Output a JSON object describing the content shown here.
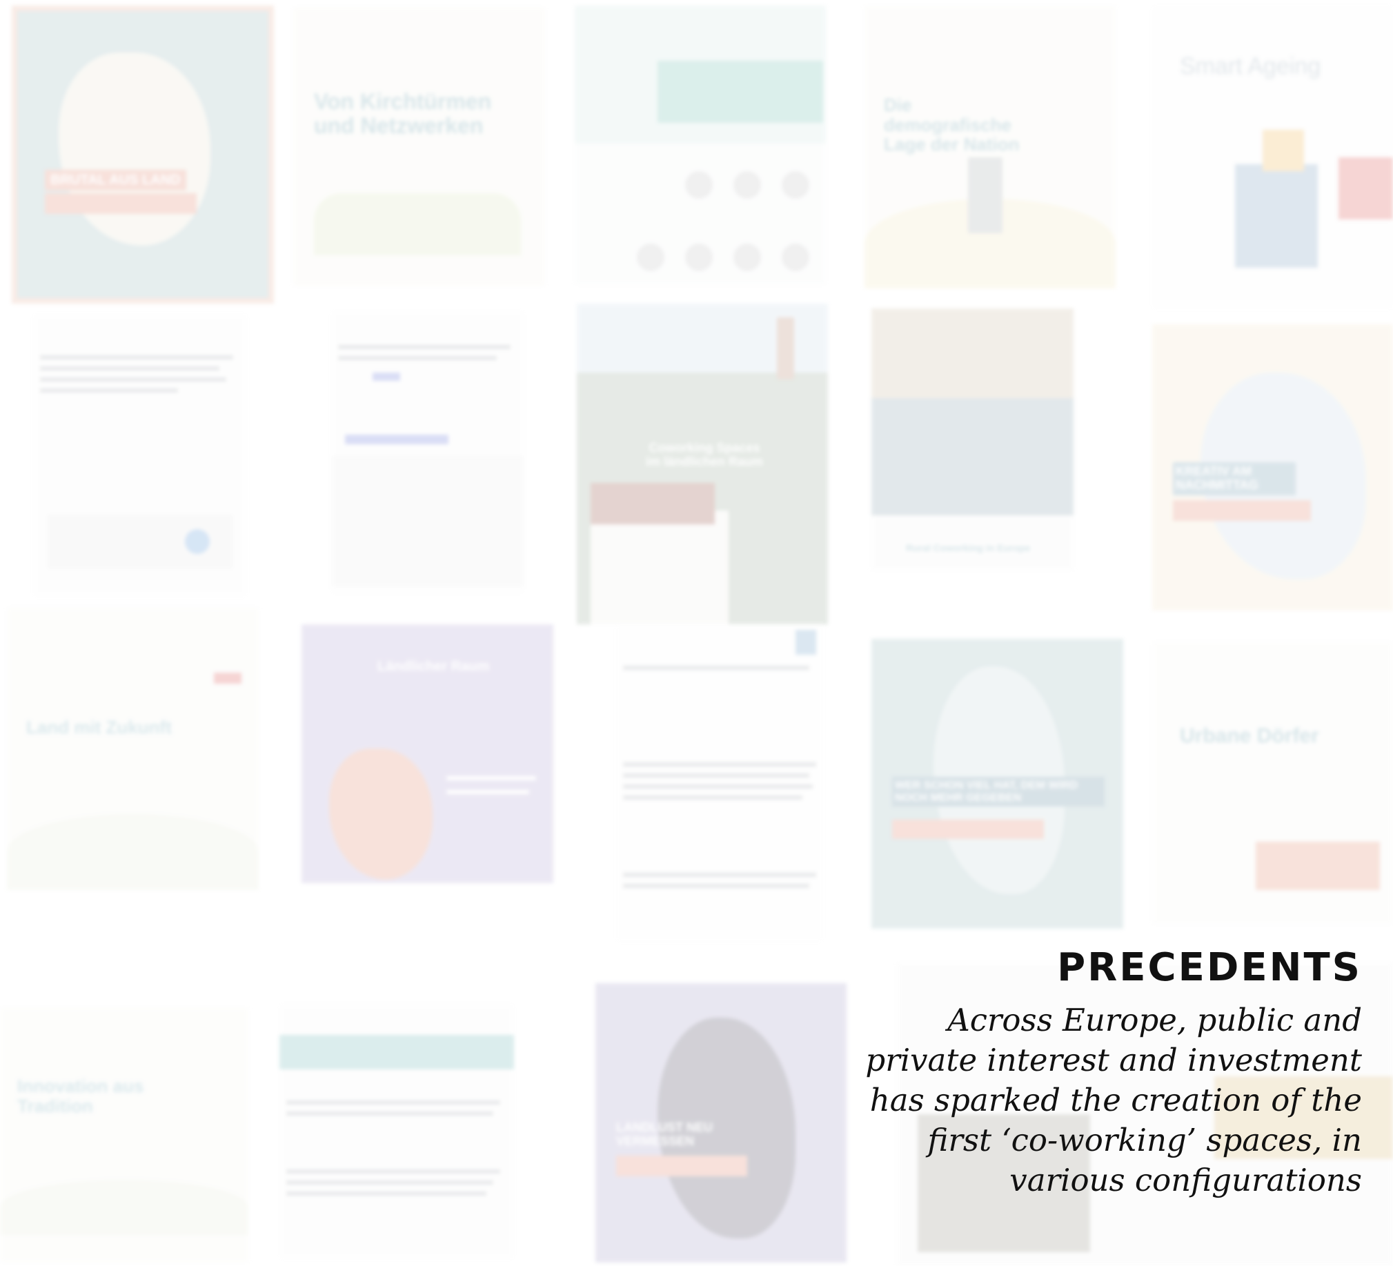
{
  "headline": "PRECEDENTS",
  "body": "Across Europe, public and private interest and investment has sparked the creation of the first ‘co-working’ spaces, in various configurations",
  "colors": {
    "text": "#111111",
    "teal": "#8fb3b6",
    "beige": "#f3e4c6",
    "lavender": "#a99bcf",
    "olive": "#f1e6b9"
  },
  "tiles": {
    "t1": "BRUTAL AUS LAND",
    "t2": "Von Kirchtürmen und Netzwerken",
    "t4": "Die demografische Lage der Nation",
    "t5": "Smart Ageing",
    "t8": "Coworking Spaces im ländlichen Raum",
    "t9": "Rural Coworking in Europe",
    "t10": "KREATIV AM NACHMITTAG",
    "t11": "Land mit Zukunft",
    "t12": "Ländlicher Raum",
    "t14": "WER SCHON VIEL HAT, DEM WIRD NOCH MEHR GEGEBEN",
    "t15": "Urbane Dörfer",
    "t16": "Innovation aus Tradition",
    "t18": "LANDLUST NEU VERMESSEN"
  }
}
